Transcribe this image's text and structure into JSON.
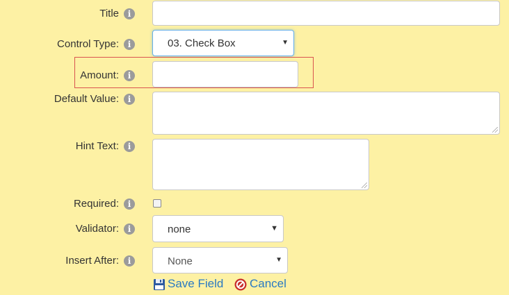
{
  "form": {
    "title": {
      "label": "Title",
      "value": ""
    },
    "control_type": {
      "label": "Control Type:",
      "selected": "03. Check Box"
    },
    "amount": {
      "label": "Amount:",
      "value": ""
    },
    "default_value": {
      "label": "Default Value:",
      "value": ""
    },
    "hint_text": {
      "label": "Hint Text:",
      "value": ""
    },
    "required": {
      "label": "Required:",
      "checked": false
    },
    "validator": {
      "label": "Validator:",
      "selected": "none"
    },
    "insert_after": {
      "label": "Insert After:",
      "selected": "None"
    }
  },
  "actions": {
    "save_label": "Save Field",
    "cancel_label": "Cancel"
  },
  "icons": {
    "info": "info-icon",
    "save": "floppy-disk-icon",
    "cancel": "cancel-icon"
  },
  "colors": {
    "background": "#fdf1a4",
    "link": "#2a7ac2",
    "highlight_border": "#d9534f",
    "focus_border": "#66afe9"
  }
}
